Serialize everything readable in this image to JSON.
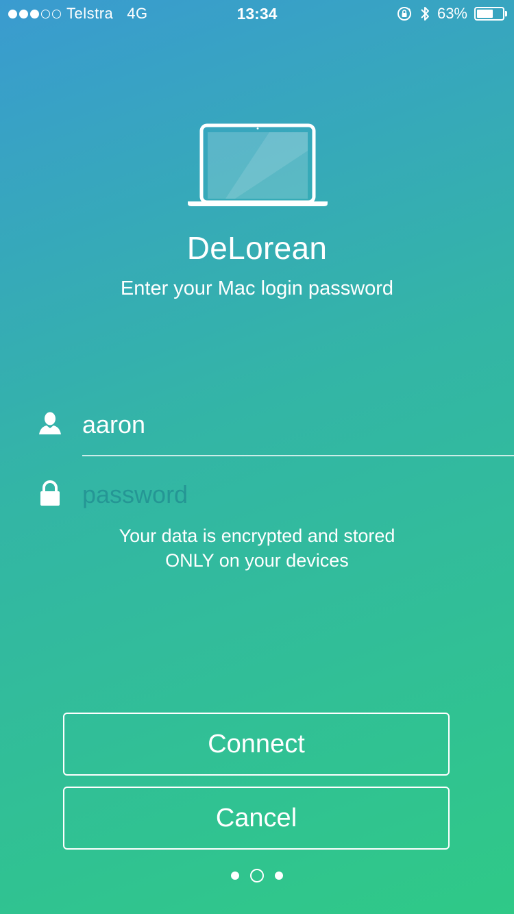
{
  "status_bar": {
    "carrier": "Telstra",
    "network": "4G",
    "time": "13:34",
    "battery_percent": "63%",
    "battery_level": 0.63,
    "signal_bars_filled": 3,
    "signal_bars_total": 5,
    "icons": [
      "rotation-lock-icon",
      "bluetooth-icon",
      "battery-icon"
    ]
  },
  "header": {
    "icon": "laptop-icon",
    "app_name": "DeLorean",
    "subtitle": "Enter your Mac login password"
  },
  "form": {
    "username": {
      "icon": "user-icon",
      "value": "aaron"
    },
    "password": {
      "icon": "lock-icon",
      "placeholder": "password",
      "value": ""
    },
    "info_line1": "Your data is encrypted and stored",
    "info_line2": "ONLY on your devices"
  },
  "actions": {
    "connect_label": "Connect",
    "cancel_label": "Cancel"
  },
  "pager": {
    "total": 3,
    "current": 2
  },
  "colors": {
    "gradient_top": "#3a9bd0",
    "gradient_mid": "#33b5a6",
    "gradient_bottom": "#2fc987",
    "text": "#ffffff"
  }
}
